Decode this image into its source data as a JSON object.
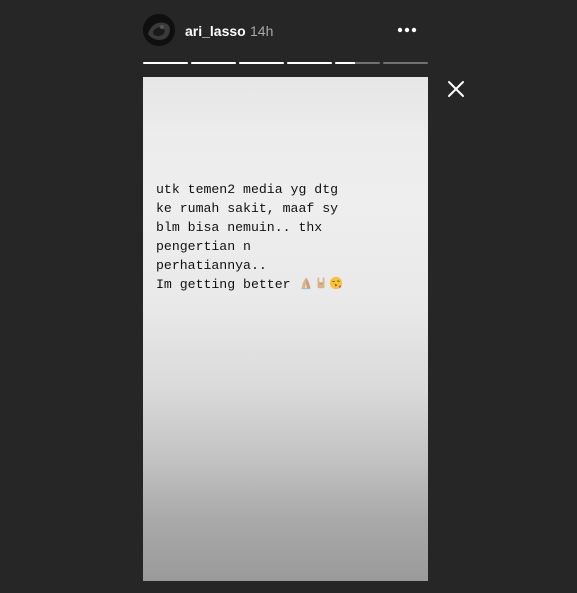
{
  "header": {
    "username": "ari_lasso",
    "time_ago": "14h"
  },
  "progress": {
    "segments": 6,
    "current_index": 4,
    "current_fill": 0.45
  },
  "story": {
    "text_lines": [
      "utk temen2 media yg dtg",
      "ke rumah sakit, maaf sy",
      "blm bisa nemuin.. thx",
      "pengertian n",
      "perhatiannya..",
      "Im getting better"
    ],
    "emojis": [
      "folded-hands",
      "sign-of-the-horns",
      "face-blowing-kiss"
    ],
    "background_colors": [
      "#e6e6e6",
      "#9a9a9a"
    ]
  },
  "controls": {
    "more_icon": "more-horizontal-icon",
    "close_icon": "close-icon"
  }
}
